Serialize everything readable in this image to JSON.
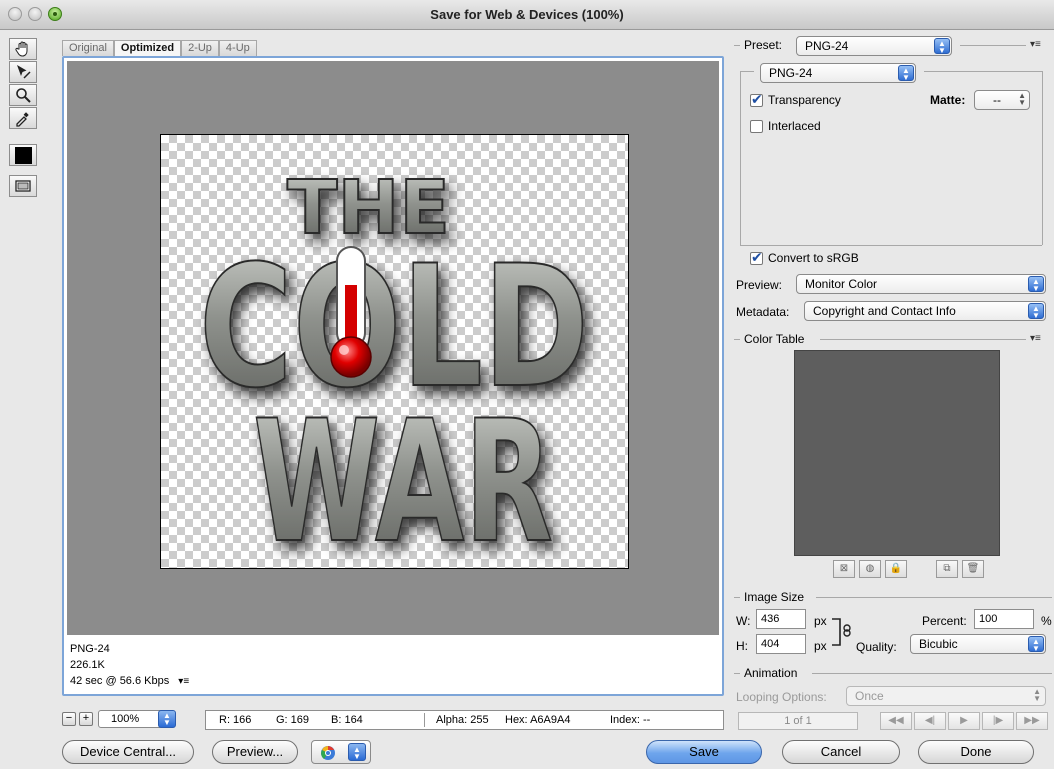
{
  "window": {
    "title": "Save for Web & Devices (100%)"
  },
  "tabs": [
    "Original",
    "Optimized",
    "2-Up",
    "4-Up"
  ],
  "image": {
    "logo_text": [
      "THE",
      "COLD",
      "WAR"
    ]
  },
  "info": {
    "format": "PNG-24",
    "size": "226.1K",
    "download": "42 sec @ 56.6 Kbps"
  },
  "zoom": {
    "value": "100%",
    "minus": "−",
    "plus": "+"
  },
  "status": {
    "r": "R: 166",
    "g": "G: 169",
    "b": "B: 164",
    "alpha": "Alpha: 255",
    "hex": "Hex: A6A9A4",
    "index": "Index: --"
  },
  "buttons": {
    "device_central": "Device Central...",
    "preview": "Preview...",
    "save": "Save",
    "cancel": "Cancel",
    "done": "Done"
  },
  "settings": {
    "preset_label": "Preset:",
    "preset_value": "PNG-24",
    "format_value": "PNG-24",
    "transparency_label": "Transparency",
    "transparency_checked": true,
    "matte_label": "Matte:",
    "matte_value": "--",
    "interlaced_label": "Interlaced",
    "interlaced_checked": false,
    "convert_srgb_label": "Convert to sRGB",
    "convert_srgb_checked": true,
    "preview_label": "Preview:",
    "preview_value": "Monitor Color",
    "metadata_label": "Metadata:",
    "metadata_value": "Copyright and Contact Info"
  },
  "color_table": {
    "title": "Color Table",
    "swatch_color": "#5e5e5e"
  },
  "image_size": {
    "title": "Image Size",
    "w_label": "W:",
    "w_value": "436",
    "h_label": "H:",
    "h_value": "404",
    "px": "px",
    "percent_label": "Percent:",
    "percent_value": "100",
    "percent_sign": "%",
    "quality_label": "Quality:",
    "quality_value": "Bicubic"
  },
  "animation": {
    "title": "Animation",
    "looping_label": "Looping Options:",
    "looping_value": "Once",
    "frame": "1 of 1"
  },
  "colors": {
    "canvas_gray": "#8c8c8c",
    "frame_blue": "#7da5d8",
    "accent_blue": "#2f6dd2"
  }
}
